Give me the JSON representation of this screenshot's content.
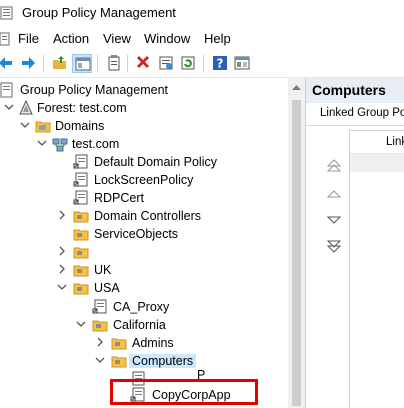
{
  "window": {
    "title": "Group Policy Management"
  },
  "menu": {
    "items": [
      "File",
      "Action",
      "View",
      "Window",
      "Help"
    ]
  },
  "toolbar": {
    "buttons": [
      "back-icon",
      "forward-icon",
      "up-folder-icon",
      "show-hide-tree-icon",
      "copy-icon",
      "delete-icon",
      "properties-icon",
      "refresh-icon",
      "help-icon",
      "console-icon"
    ]
  },
  "tree": {
    "root": "Group Policy Management",
    "forest": "Forest: test.com",
    "domains": "Domains",
    "domain": "test.com",
    "items": {
      "default_domain_policy": "Default Domain Policy",
      "lockscreen_policy": "LockScreenPolicy",
      "rdpcert": "RDPCert",
      "domain_controllers": "Domain Controllers",
      "service_objects": "ServiceObjects",
      "blank_ou": "",
      "uk": "UK",
      "usa": "USA",
      "ca_proxy": "CA_Proxy",
      "california": "California",
      "admins": "Admins",
      "computers": "Computers",
      "partial_gpo": "P",
      "copycorpapp": "CopyCorpApp"
    }
  },
  "right_pane": {
    "title": "Computers",
    "tab": "Linked Group Policy Objects",
    "column": "Link Order"
  },
  "colors": {
    "highlight": "#e00000",
    "selection": "#cce8ff",
    "folder": "#f5c242"
  }
}
